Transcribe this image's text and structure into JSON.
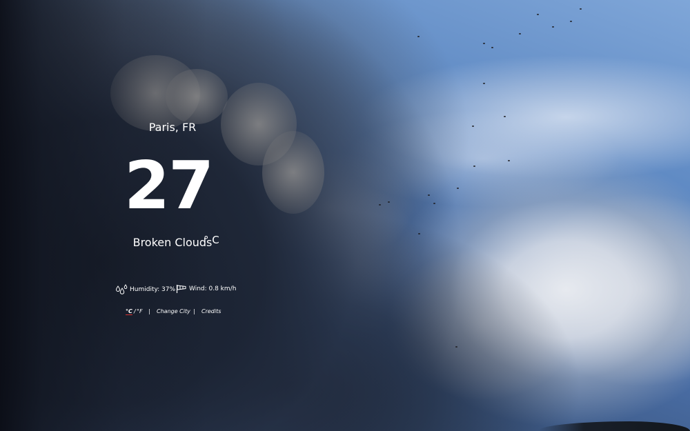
{
  "location": {
    "city": "Paris, FR"
  },
  "current": {
    "temperature": "27",
    "unit": "° C",
    "description": "Broken Clouds"
  },
  "stats": {
    "humidity": "Humidity: 37%",
    "wind": "Wind: 0.8 km/h"
  },
  "links": {
    "celsius": "°C",
    "slash": "/",
    "fahrenheit": "°F",
    "separator_1": "|",
    "change_city": "Change City",
    "separator_2": "|",
    "credits": "Credits"
  },
  "colors": {
    "text": "#ffffff",
    "active_unit_underline": "#dd3333"
  },
  "icons": {
    "humidity": "droplets-icon",
    "wind": "windsock-icon"
  }
}
